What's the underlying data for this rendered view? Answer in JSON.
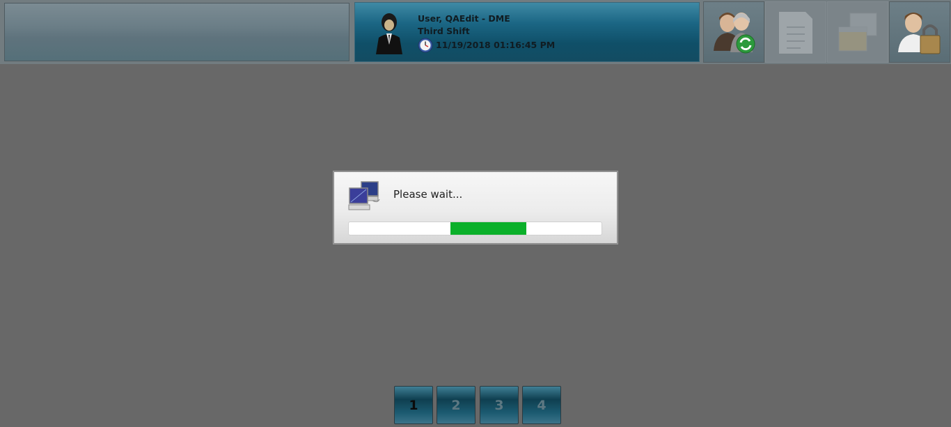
{
  "header": {
    "user_name": "User, QAEdit - DME",
    "shift": "Third Shift",
    "datetime": "11/19/2018 01:16:45 PM"
  },
  "toolbar": {
    "buttons": [
      {
        "icon": "users-refresh-icon",
        "state": "active"
      },
      {
        "icon": "document-list-icon",
        "state": "disabled"
      },
      {
        "icon": "windows-icon",
        "state": "disabled"
      },
      {
        "icon": "user-lock-icon",
        "state": "active"
      }
    ]
  },
  "dialog": {
    "message": "Please wait...",
    "icon": "network-computers-icon",
    "progress_color": "#0bb02a"
  },
  "pager": {
    "pages": [
      "1",
      "2",
      "3",
      "4"
    ],
    "current": "1"
  }
}
